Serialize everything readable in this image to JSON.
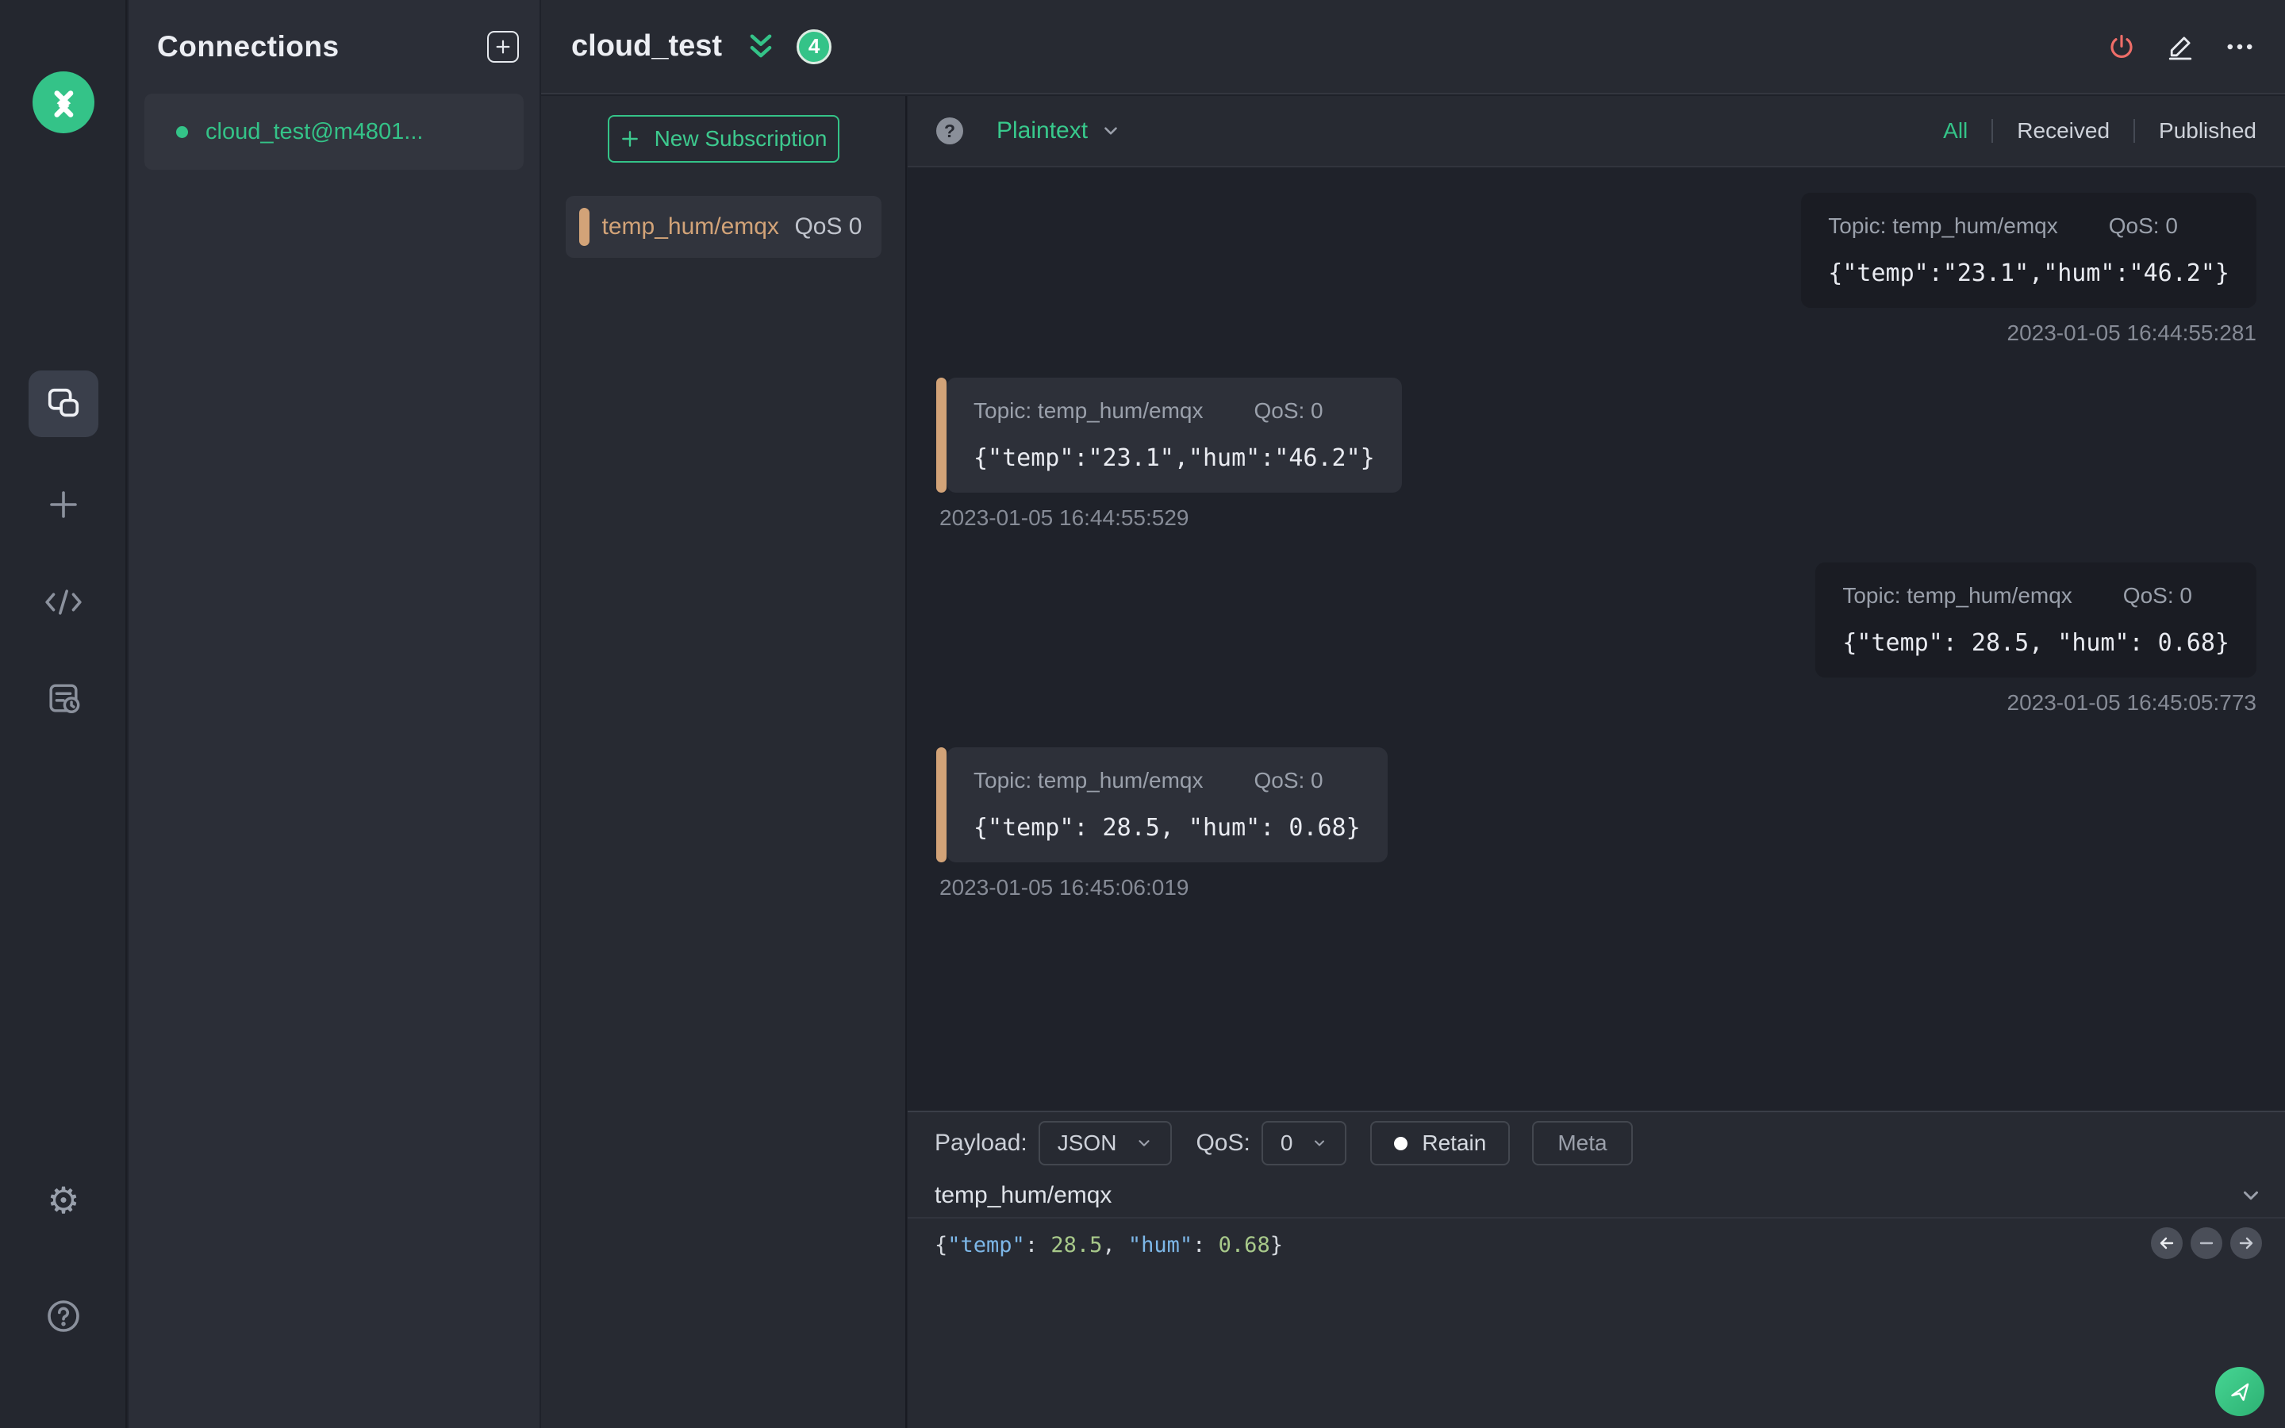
{
  "theme": {
    "accent_green": "#34c388",
    "danger_red": "#ee6d68",
    "topic_tan": "#d2a378"
  },
  "sidebar": {
    "logo": "mqttx-logo",
    "items": [
      "connections",
      "new-connection",
      "script",
      "log"
    ],
    "footer": [
      "settings",
      "help"
    ]
  },
  "connections": {
    "title": "Connections",
    "items": [
      {
        "label": "cloud_test@m4801...",
        "status": "connected"
      }
    ]
  },
  "header": {
    "connection_name": "cloud_test",
    "badge_count": "4"
  },
  "subscriptions": {
    "new_button_label": "New Subscription",
    "items": [
      {
        "topic": "temp_hum/emqx",
        "qos": "QoS 0"
      }
    ]
  },
  "filter_bar": {
    "help": "?",
    "format": "Plaintext",
    "tabs": [
      "All",
      "Received",
      "Published"
    ],
    "active_tab": "All"
  },
  "messages": [
    {
      "type": "published",
      "topic": "Topic: temp_hum/emqx",
      "qos": "QoS: 0",
      "payload": "{\"temp\":\"23.1\",\"hum\":\"46.2\"}",
      "time": "2023-01-05 16:44:55:281"
    },
    {
      "type": "received",
      "topic": "Topic: temp_hum/emqx",
      "qos": "QoS: 0",
      "payload": "{\"temp\":\"23.1\",\"hum\":\"46.2\"}",
      "time": "2023-01-05 16:44:55:529"
    },
    {
      "type": "published",
      "topic": "Topic: temp_hum/emqx",
      "qos": "QoS: 0",
      "payload": "{\"temp\": 28.5, \"hum\": 0.68}",
      "time": "2023-01-05 16:45:05:773"
    },
    {
      "type": "received",
      "topic": "Topic: temp_hum/emqx",
      "qos": "QoS: 0",
      "payload": "{\"temp\": 28.5, \"hum\": 0.68}",
      "time": "2023-01-05 16:45:06:019"
    }
  ],
  "publish": {
    "payload_label": "Payload:",
    "format_value": "JSON",
    "qos_label": "QoS:",
    "qos_value": "0",
    "retain_label": "Retain",
    "meta_label": "Meta",
    "topic_value": "temp_hum/emqx",
    "editor_tokens": [
      {
        "text": "{",
        "color": "#d5d9df"
      },
      {
        "text": "\"temp\"",
        "color": "#7db7e8"
      },
      {
        "text": ": ",
        "color": "#d5d9df"
      },
      {
        "text": "28.5",
        "color": "#a8c98a"
      },
      {
        "text": ", ",
        "color": "#d5d9df"
      },
      {
        "text": "\"hum\"",
        "color": "#7db7e8"
      },
      {
        "text": ": ",
        "color": "#d5d9df"
      },
      {
        "text": "0.68",
        "color": "#a8c98a"
      },
      {
        "text": "}",
        "color": "#d5d9df"
      }
    ]
  }
}
